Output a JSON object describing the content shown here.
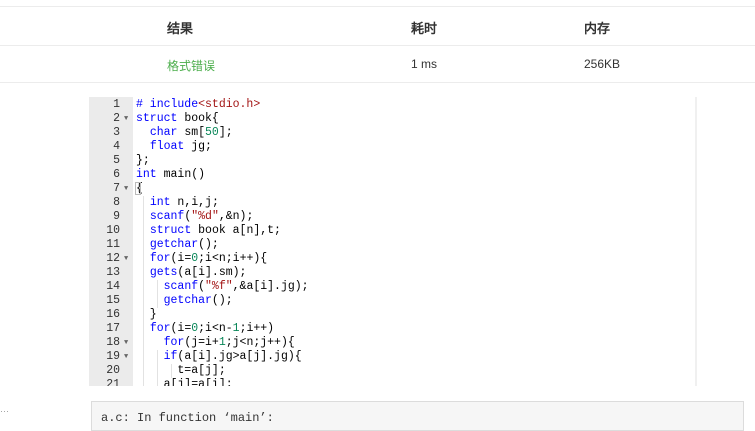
{
  "results": {
    "headers": [
      "结果",
      "耗时",
      "内存"
    ],
    "row": {
      "result": "格式错误",
      "time": "1 ms",
      "memory": "256KB"
    },
    "colors": {
      "result_status": "#4cae4c"
    }
  },
  "editor": {
    "lines": [
      {
        "n": "1",
        "fold": false,
        "segs": [
          {
            "t": "# include",
            "c": "pp"
          },
          {
            "t": "<stdio.h>",
            "c": "pph"
          }
        ]
      },
      {
        "n": "2",
        "fold": true,
        "segs": [
          {
            "t": "struct",
            "c": "kw"
          },
          {
            "t": " book{"
          }
        ]
      },
      {
        "n": "3",
        "fold": false,
        "segs": [
          {
            "t": "  "
          },
          {
            "t": "char",
            "c": "kw"
          },
          {
            "t": " sm["
          },
          {
            "t": "50",
            "c": "num"
          },
          {
            "t": "];"
          }
        ]
      },
      {
        "n": "4",
        "fold": false,
        "segs": [
          {
            "t": "  "
          },
          {
            "t": "float",
            "c": "kw"
          },
          {
            "t": " jg;"
          }
        ]
      },
      {
        "n": "5",
        "fold": false,
        "segs": [
          {
            "t": "};"
          }
        ]
      },
      {
        "n": "6",
        "fold": false,
        "segs": [
          {
            "t": "int",
            "c": "kw"
          },
          {
            "t": " main()"
          }
        ]
      },
      {
        "n": "7",
        "fold": true,
        "cursor": true,
        "segs": [
          {
            "t": "{"
          }
        ]
      },
      {
        "n": "8",
        "fold": false,
        "segs": [
          {
            "t": "  "
          },
          {
            "t": "int",
            "c": "kw"
          },
          {
            "t": " n,i,j;"
          }
        ]
      },
      {
        "n": "9",
        "fold": false,
        "segs": [
          {
            "t": "  "
          },
          {
            "t": "scanf",
            "c": "kw"
          },
          {
            "t": "("
          },
          {
            "t": "\"%d\"",
            "c": "str"
          },
          {
            "t": ",&n);"
          }
        ]
      },
      {
        "n": "10",
        "fold": false,
        "segs": [
          {
            "t": "  "
          },
          {
            "t": "struct",
            "c": "kw"
          },
          {
            "t": " book a[n],t;"
          }
        ]
      },
      {
        "n": "11",
        "fold": false,
        "segs": [
          {
            "t": "  "
          },
          {
            "t": "getchar",
            "c": "kw"
          },
          {
            "t": "();"
          }
        ]
      },
      {
        "n": "12",
        "fold": true,
        "segs": [
          {
            "t": "  "
          },
          {
            "t": "for",
            "c": "kw"
          },
          {
            "t": "(i="
          },
          {
            "t": "0",
            "c": "num"
          },
          {
            "t": ";i<n;i++){"
          }
        ]
      },
      {
        "n": "13",
        "fold": false,
        "segs": [
          {
            "t": "  "
          },
          {
            "t": "gets",
            "c": "kw"
          },
          {
            "t": "(a[i].sm);"
          }
        ]
      },
      {
        "n": "14",
        "fold": false,
        "segs": [
          {
            "t": "    "
          },
          {
            "t": "scanf",
            "c": "kw"
          },
          {
            "t": "("
          },
          {
            "t": "\"%f\"",
            "c": "str"
          },
          {
            "t": ",&a[i].jg);"
          }
        ]
      },
      {
        "n": "15",
        "fold": false,
        "segs": [
          {
            "t": "    "
          },
          {
            "t": "getchar",
            "c": "kw"
          },
          {
            "t": "();"
          }
        ]
      },
      {
        "n": "16",
        "fold": false,
        "segs": [
          {
            "t": "  }"
          }
        ]
      },
      {
        "n": "17",
        "fold": false,
        "segs": [
          {
            "t": "  "
          },
          {
            "t": "for",
            "c": "kw"
          },
          {
            "t": "(i="
          },
          {
            "t": "0",
            "c": "num"
          },
          {
            "t": ";i<n-"
          },
          {
            "t": "1",
            "c": "num"
          },
          {
            "t": ";i++)"
          }
        ]
      },
      {
        "n": "18",
        "fold": true,
        "segs": [
          {
            "t": "    "
          },
          {
            "t": "for",
            "c": "kw"
          },
          {
            "t": "(j=i+"
          },
          {
            "t": "1",
            "c": "num"
          },
          {
            "t": ";j<n;j++){"
          }
        ]
      },
      {
        "n": "19",
        "fold": true,
        "segs": [
          {
            "t": "    "
          },
          {
            "t": "if",
            "c": "kw"
          },
          {
            "t": "(a[i].jg>a[j].jg){"
          }
        ]
      },
      {
        "n": "20",
        "fold": false,
        "segs": [
          {
            "t": "      t=a[j];"
          }
        ]
      },
      {
        "n": "21",
        "fold": false,
        "segs": [
          {
            "t": "    a[j]=a[i];"
          }
        ]
      }
    ]
  },
  "compile_output": {
    "text": "a.c: In function ‘main’:"
  },
  "icons": {
    "fold": "fold-arrow-icon",
    "corner": "scroll-corner-icon"
  }
}
